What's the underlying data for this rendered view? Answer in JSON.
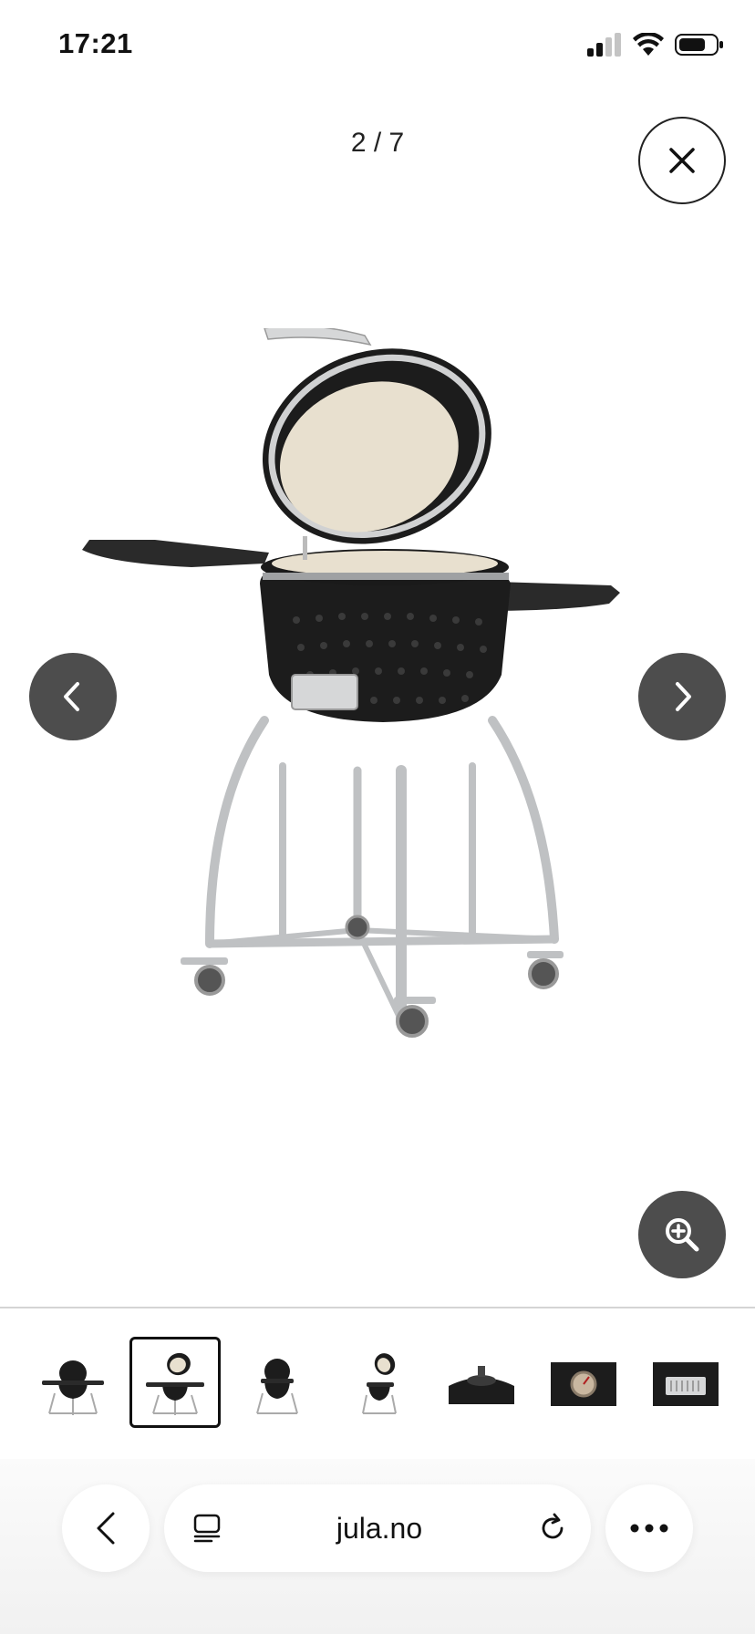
{
  "status_bar": {
    "time": "17:21"
  },
  "gallery": {
    "counter": "2 / 7",
    "current_index": 2,
    "total": 7
  },
  "thumbnails": [
    {
      "name": "thumb-grill-closed",
      "selected": false
    },
    {
      "name": "thumb-grill-open",
      "selected": true
    },
    {
      "name": "thumb-grill-closed-side",
      "selected": false
    },
    {
      "name": "thumb-grill-open-side",
      "selected": false
    },
    {
      "name": "thumb-vent-cap",
      "selected": false
    },
    {
      "name": "thumb-thermometer",
      "selected": false
    },
    {
      "name": "thumb-bottom-vent",
      "selected": false
    }
  ],
  "browser": {
    "url": "jula.no"
  },
  "colors": {
    "overlay_button": "#4d4d4d",
    "grill_black": "#1c1c1c",
    "ceramic": "#e8e0cf",
    "steel": "#c9cbcd"
  }
}
